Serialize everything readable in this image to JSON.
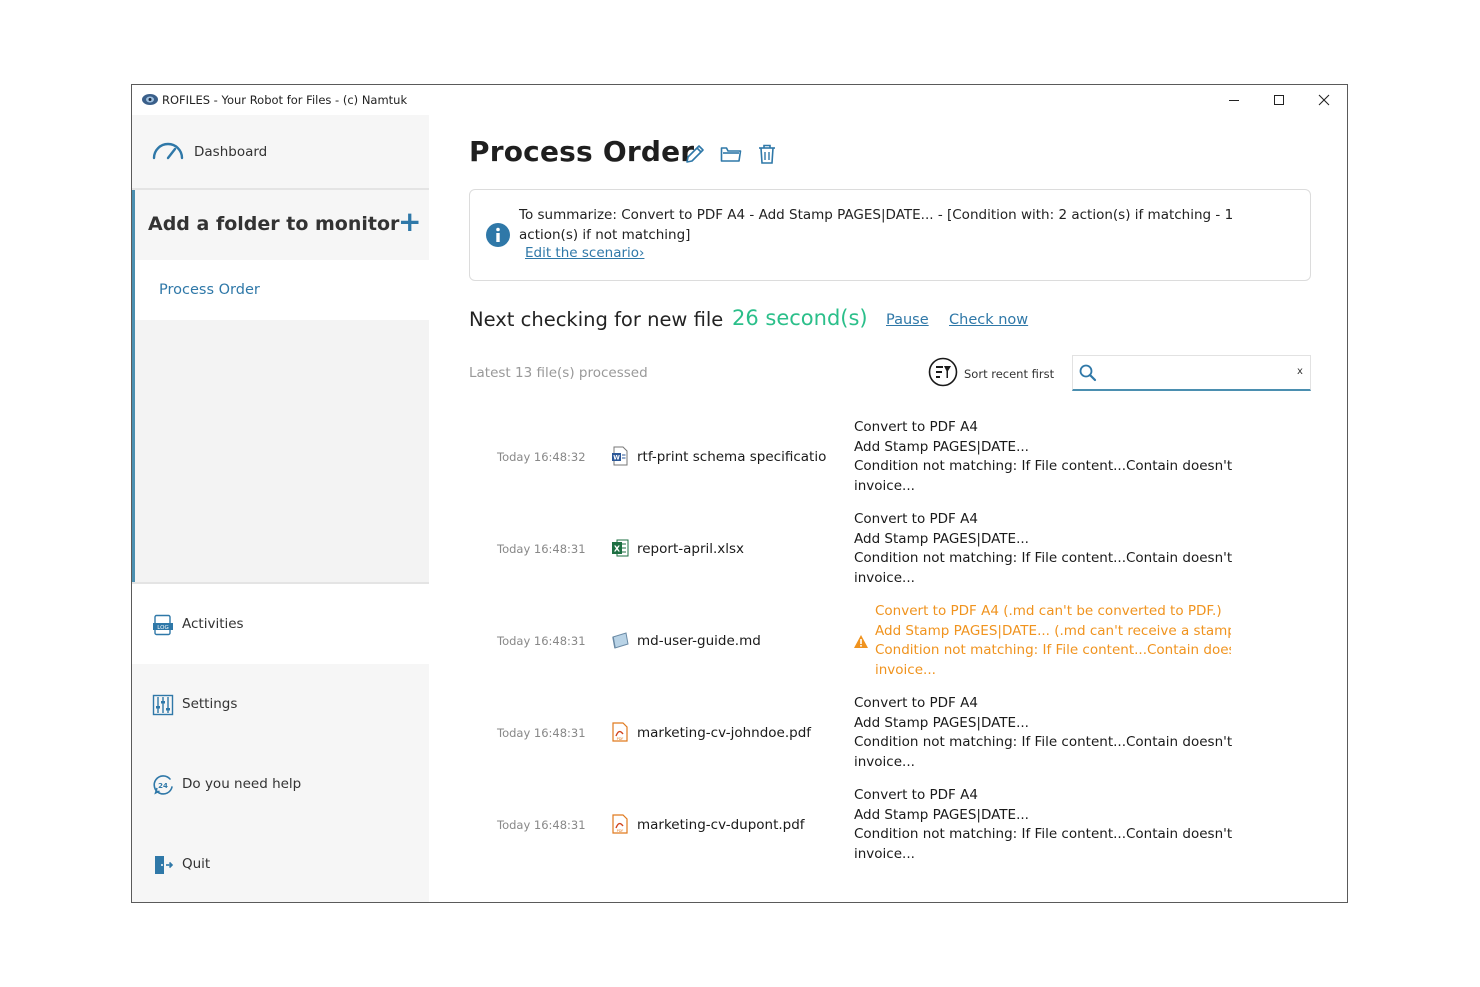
{
  "window": {
    "title": "ROFILES - Your Robot for Files - (c) Namtuk",
    "controls": [
      "minimize-icon",
      "maximize-icon",
      "close-icon"
    ]
  },
  "sidebar": {
    "dashboard_label": "Dashboard",
    "folders_header": "Add a folder to monitor",
    "folders_add": "+",
    "folders": [
      {
        "label": "Process Order",
        "selected": true
      }
    ],
    "items": [
      {
        "label": "Activities",
        "icon": "log-icon"
      },
      {
        "label": "Settings",
        "icon": "settings-icon"
      },
      {
        "label": "Do you need help",
        "icon": "help-24-icon"
      },
      {
        "label": "Quit",
        "icon": "exit-icon"
      }
    ]
  },
  "main": {
    "title": "Process Order",
    "title_icons": [
      "edit-icon",
      "open-folder-icon",
      "delete-icon"
    ],
    "summary_text": "To summarize: Convert to PDF A4 - Add Stamp PAGES|DATE... - [Condition with: 2 action(s) if matching - 1 action(s) if not matching]",
    "edit_link": "Edit the scenario›",
    "next_check_label": "Next checking for new file",
    "countdown": "26 second(s)",
    "pause_label": "Pause",
    "check_now_label": "Check now",
    "latest_label": "Latest 13 file(s) processed",
    "sort_label": "Sort recent first",
    "search": {
      "value": "",
      "placeholder": "",
      "clear": "x"
    },
    "accent_color": "#2f78a8",
    "countdown_color": "#2bbf8a",
    "warning_color": "#f0931e"
  },
  "files": [
    {
      "time": "Today 16:48:32",
      "name": "rtf-print schema specificatio",
      "icon": "word-doc-icon",
      "warning": false,
      "actions": [
        "Convert to PDF A4",
        "Add Stamp PAGES|DATE...",
        "Condition not matching: If File content...Contain doesn't m",
        "invoice..."
      ]
    },
    {
      "time": "Today 16:48:31",
      "name": "report-april.xlsx",
      "icon": "excel-icon",
      "warning": false,
      "actions": [
        "Convert to PDF A4",
        "Add Stamp PAGES|DATE...",
        "Condition not matching: If File content...Contain doesn't m",
        "invoice..."
      ]
    },
    {
      "time": "Today 16:48:31",
      "name": "md-user-guide.md",
      "icon": "markdown-icon",
      "warning": true,
      "actions": [
        "Convert to PDF A4 (.md can't be converted to PDF.)",
        "Add Stamp PAGES|DATE... (.md can't receive a stamp, o",
        "Condition not matching: If File content...Contain doesn'",
        "invoice..."
      ]
    },
    {
      "time": "Today 16:48:31",
      "name": "marketing-cv-johndoe.pdf",
      "icon": "pdf-icon",
      "warning": false,
      "actions": [
        "Convert to PDF A4",
        "Add Stamp PAGES|DATE...",
        "Condition not matching: If File content...Contain doesn't m",
        "invoice..."
      ]
    },
    {
      "time": "Today 16:48:31",
      "name": "marketing-cv-dupont.pdf",
      "icon": "pdf-icon",
      "warning": false,
      "actions": [
        "Convert to PDF A4",
        "Add Stamp PAGES|DATE...",
        "Condition not matching: If File content...Contain doesn't m",
        "invoice..."
      ]
    }
  ]
}
